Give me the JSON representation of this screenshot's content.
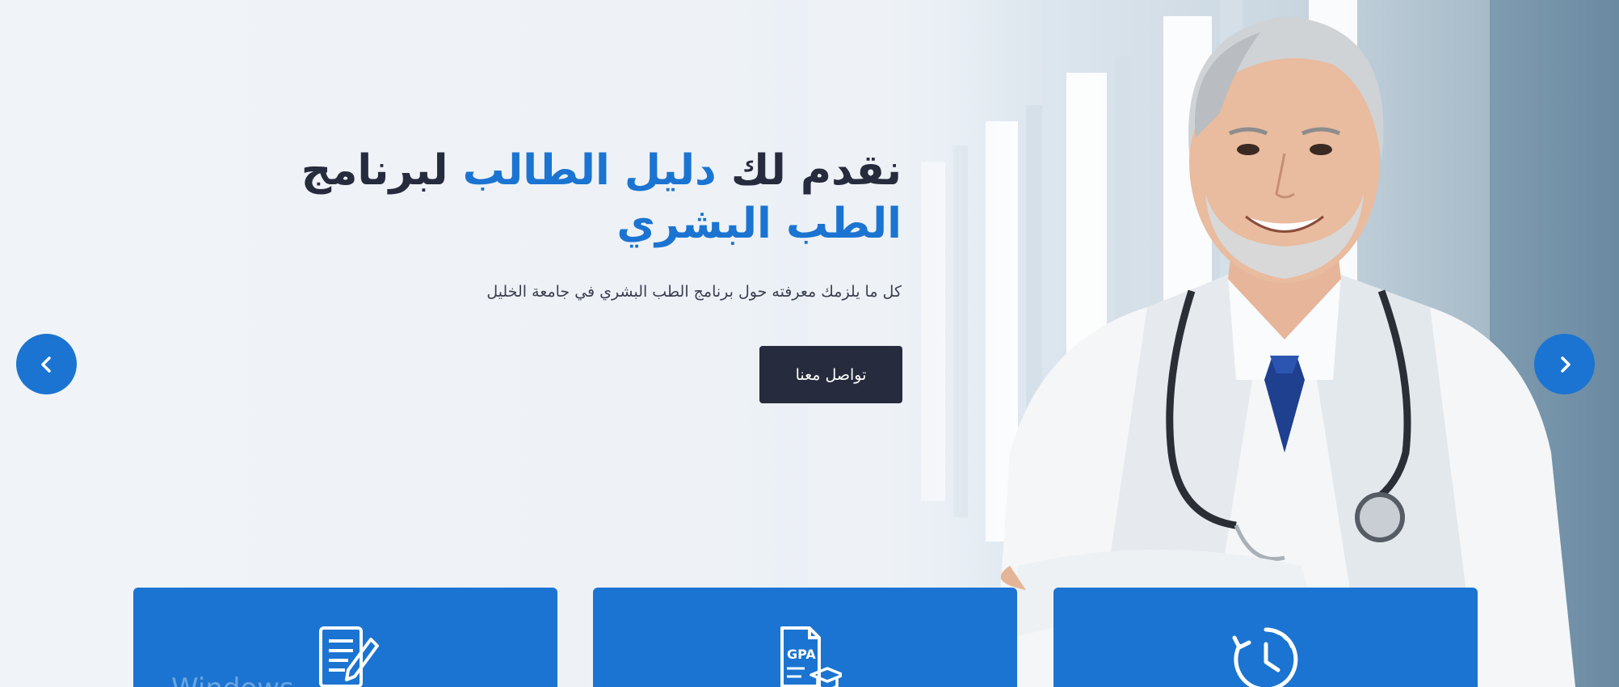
{
  "hero": {
    "headline_part1": "نقدم لك ",
    "headline_accent1": "دليل الطالب",
    "headline_part2": " لبرنامج ",
    "headline_accent2": "الطب البشري",
    "subtitle": "كل ما يلزمك معرفته حول برنامج الطب البشري في جامعة الخليل",
    "cta_label": "تواصل معنا"
  },
  "carousel": {
    "prev_icon": "chevron-left-icon",
    "next_icon": "chevron-right-icon"
  },
  "cards": [
    {
      "icon": "document-edit-icon"
    },
    {
      "icon": "gpa-certificate-icon"
    },
    {
      "icon": "clock-history-icon"
    }
  ],
  "watermark": "Windows",
  "colors": {
    "accent": "#1b74d1",
    "dark": "#262b3d",
    "background": "#eef3f8"
  }
}
